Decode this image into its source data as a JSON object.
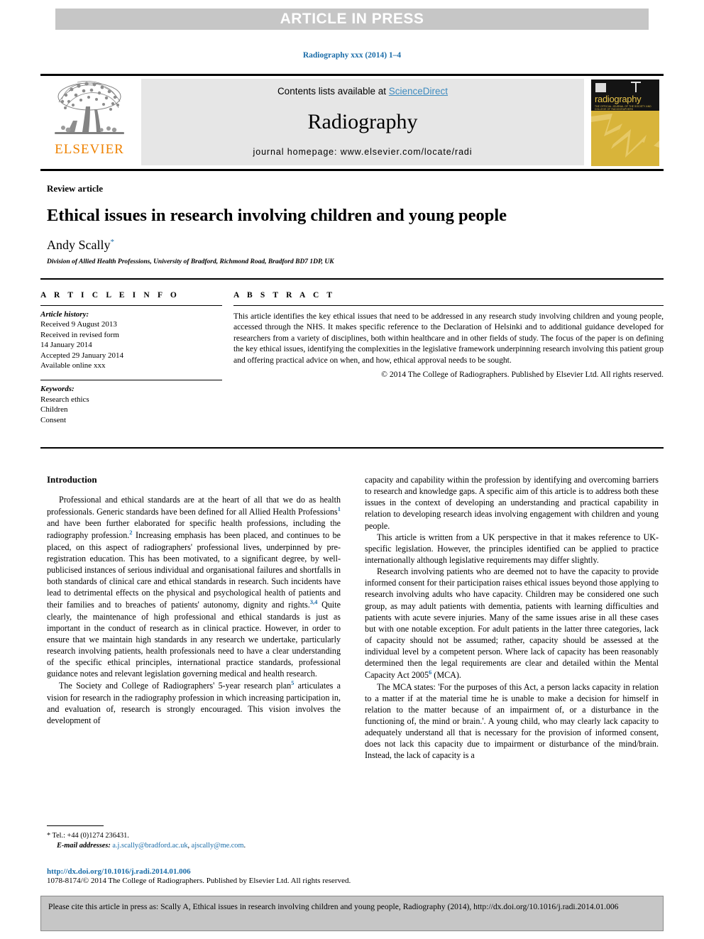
{
  "banner": {
    "text": "ARTICLE IN PRESS"
  },
  "journal_ref": "Radiography xxx (2014) 1–4",
  "masthead": {
    "publisher": "ELSEVIER",
    "contents_prefix": "Contents lists available at ",
    "contents_link": "ScienceDirect",
    "journal_name": "Radiography",
    "homepage": "journal homepage: www.elsevier.com/locate/radi",
    "cover_title": "radiography",
    "cover_subtitle": "THE OFFICIAL JOURNAL OF THE SOCIETY AND COLLEGE OF RADIOGRAPHERS"
  },
  "article": {
    "kicker": "Review article",
    "title": "Ethical issues in research involving children and young people",
    "author": "Andy Scally",
    "author_marker": "*",
    "affiliation": "Division of Allied Health Professions, University of Bradford, Richmond Road, Bradford BD7 1DP, UK"
  },
  "info": {
    "heading": "A R T I C L E   I N F O",
    "history_label": "Article history:",
    "history": [
      "Received 9 August 2013",
      "Received in revised form",
      "14 January 2014",
      "Accepted 29 January 2014",
      "Available online xxx"
    ],
    "keywords_label": "Keywords:",
    "keywords": [
      "Research ethics",
      "Children",
      "Consent"
    ]
  },
  "abstract": {
    "heading": "A B S T R A C T",
    "text": "This article identifies the key ethical issues that need to be addressed in any research study involving children and young people, accessed through the NHS. It makes specific reference to the Declaration of Helsinki and to additional guidance developed for researchers from a variety of disciplines, both within healthcare and in other fields of study. The focus of the paper is on defining the key ethical issues, identifying the complexities in the legislative framework underpinning research involving this patient group and offering practical advice on when, and how, ethical approval needs to be sought.",
    "copyright": "© 2014 The College of Radiographers. Published by Elsevier Ltd. All rights reserved."
  },
  "body": {
    "section_title": "Introduction",
    "left_paragraphs": [
      {
        "segments": [
          {
            "t": "Professional and ethical standards are at the heart of all that we do as health professionals. Generic standards have been defined for all Allied Health Professions"
          },
          {
            "ref": "1"
          },
          {
            "t": " and have been further elaborated for specific health professions, including the radiography profession."
          },
          {
            "ref": "2"
          },
          {
            "t": " Increasing emphasis has been placed, and continues to be placed, on this aspect of radiographers' professional lives, underpinned by pre-registration education. This has been motivated, to a significant degree, by well-publicised instances of serious individual and organisational failures and shortfalls in both standards of clinical care and ethical standards in research. Such incidents have lead to detrimental effects on the physical and psychological health of patients and their families and to breaches of patients' autonomy, dignity and rights."
          },
          {
            "ref": "3,4"
          },
          {
            "t": " Quite clearly, the maintenance of high professional and ethical standards is just as important in the conduct of research as in clinical practice. However, in order to ensure that we maintain high standards in any research we undertake, particularly research involving patients, health professionals need to have a clear understanding of the specific ethical principles, international practice standards, professional guidance notes and relevant legislation governing medical and health research."
          }
        ]
      },
      {
        "segments": [
          {
            "t": "The Society and College of Radiographers' 5-year research plan"
          },
          {
            "ref": "5"
          },
          {
            "t": " articulates a vision for research in the radiography profession in which increasing participation in, and evaluation of, research is strongly encouraged. This vision involves the development of"
          }
        ]
      }
    ],
    "right_paragraphs": [
      {
        "segments": [
          {
            "t": "capacity and capability within the profession by identifying and overcoming barriers to research and knowledge gaps. A specific aim of this article is to address both these issues in the context of developing an understanding and practical capability in relation to developing research ideas involving engagement with children and young people."
          }
        ],
        "no_indent": true
      },
      {
        "segments": [
          {
            "t": "This article is written from a UK perspective in that it makes reference to UK-specific legislation. However, the principles identified can be applied to practice internationally although legislative requirements may differ slightly."
          }
        ]
      },
      {
        "segments": [
          {
            "t": "Research involving patients who are deemed not to have the capacity to provide informed consent for their participation raises ethical issues beyond those applying to research involving adults who have capacity. Children may be considered one such group, as may adult patients with dementia, patients with learning difficulties and patients with acute severe injuries. Many of the same issues arise in all these cases but with one notable exception. For adult patients in the latter three categories, lack of capacity should not be assumed; rather, capacity should be assessed at the individual level by a competent person. Where lack of capacity has been reasonably determined then the legal requirements are clear and detailed within the Mental Capacity Act 2005"
          },
          {
            "ref": "6"
          },
          {
            "t": " (MCA)."
          }
        ]
      },
      {
        "segments": [
          {
            "t": "The MCA states: 'For the purposes of this Act, a person lacks capacity in relation to a matter if at the material time he is unable to make a decision for himself in relation to the matter because of an impairment of, or a disturbance in the functioning of, the mind or brain.'. A young child, who may clearly lack capacity to adequately understand all that is necessary for the provision of informed consent, does not lack this capacity due to impairment or disturbance of the mind/brain. Instead, the lack of capacity is a"
          }
        ]
      }
    ]
  },
  "footnote": {
    "tel": "* Tel.: +44 (0)1274 236431.",
    "email_label": "E-mail addresses:",
    "emails": [
      "a.j.scally@bradford.ac.uk",
      "ajscally@me.com"
    ]
  },
  "bottom": {
    "doi": "http://dx.doi.org/10.1016/j.radi.2014.01.006",
    "issn": "1078-8174/© 2014 The College of Radiographers. Published by Elsevier Ltd. All rights reserved."
  },
  "cite_box": {
    "text": "Please cite this article in press as: Scally A, Ethical issues in research involving children and young people, Radiography (2014), http://dx.doi.org/10.1016/j.radi.2014.01.006"
  },
  "colors": {
    "link": "#1a6ca8",
    "banner_bg": "#c6c6c6",
    "masthead_bg": "#e6e6e6",
    "elsevier_orange": "#ef8200",
    "cover_yellow": "#d8b43a"
  }
}
